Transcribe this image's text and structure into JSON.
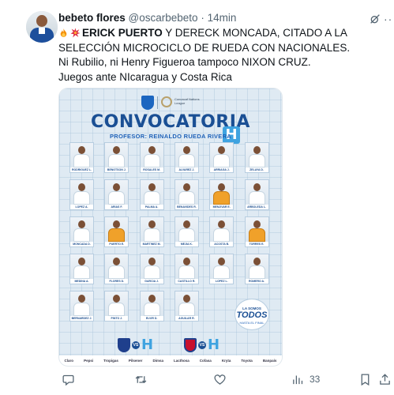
{
  "tweet": {
    "author_name": "bebeto flores",
    "handle": "@oscarbebeto",
    "separator": "·",
    "time": "14min",
    "lines": [
      {
        "prefix": "",
        "bold": "ERICK PUERTO",
        "rest": " Y DERECK MONCADA, CITADO A LA SELECCIÓN MICROCICLO DE RUEDA CON NACIONALES."
      },
      {
        "prefix": "",
        "bold": "",
        "rest": "Ni Rubilio, ni Henry Figueroa tampoco NIXON CRUZ."
      },
      {
        "prefix": "",
        "bold": "",
        "rest": "Juegos ante NIcaragua y Costa Rica"
      }
    ],
    "emojis": [
      "fire-emoji",
      "collision-emoji"
    ]
  },
  "poster": {
    "title": "CONVOCATORIA",
    "title_badge": "H",
    "subtitle": "PROFESOR: REINALDO RUEDA RIVERA",
    "brand_text": "Concacaf Nations League",
    "players": [
      {
        "name": "RODRIGUEZ L.",
        "gk": false
      },
      {
        "name": "BENGTSON J.",
        "gk": false
      },
      {
        "name": "ROSALES M.",
        "gk": false
      },
      {
        "name": "ALVAREZ J.",
        "gk": false
      },
      {
        "name": "ARRIAGA J.",
        "gk": false
      },
      {
        "name": "ZELAYA D.",
        "gk": false
      },
      {
        "name": "LOPEZ A.",
        "gk": false
      },
      {
        "name": "ARIAS F.",
        "gk": false
      },
      {
        "name": "PALMA A.",
        "gk": false
      },
      {
        "name": "BENAVIDES R.",
        "gk": false
      },
      {
        "name": "MENJIVAR E.",
        "gk": true
      },
      {
        "name": "ARBOLEDA L.",
        "gk": false
      },
      {
        "name": "MONCADA D.",
        "gk": false
      },
      {
        "name": "PUERTO E.",
        "gk": true
      },
      {
        "name": "MARTINEZ M.",
        "gk": false
      },
      {
        "name": "MEJIA K.",
        "gk": false
      },
      {
        "name": "ACOSTA B.",
        "gk": false
      },
      {
        "name": "TORRES E.",
        "gk": true
      },
      {
        "name": "MEDINA A.",
        "gk": false
      },
      {
        "name": "FLORES D.",
        "gk": false
      },
      {
        "name": "GARCIA J.",
        "gk": false
      },
      {
        "name": "CASTILLO R.",
        "gk": false
      },
      {
        "name": "LOPEZ L.",
        "gk": false
      },
      {
        "name": "ROMERO A.",
        "gk": false
      },
      {
        "name": "BERNARDEZ J.",
        "gk": false
      },
      {
        "name": "PINTO J.",
        "gk": false
      },
      {
        "name": "ELVIR D.",
        "gk": false
      },
      {
        "name": "AGUILAR R.",
        "gk": false
      }
    ],
    "todos": {
      "top": "LA SOMOS",
      "main": "TODOS",
      "bottom": "HASTA EL FINAL"
    },
    "matches": [
      {
        "team_color": "#1f3f8c",
        "vs": "VS",
        "home": "H"
      },
      {
        "team_color": "#c8102e",
        "vs": "VS",
        "home": "H"
      }
    ],
    "sponsors": [
      "Claro",
      "Pepsi",
      "Tropigas",
      "Pilsener",
      "Dimsa",
      "Lacthosa",
      "Cofasa",
      "Kryta",
      "Toyota",
      "Banpaís"
    ]
  },
  "actions": {
    "reply_count": "",
    "retweet_count": "",
    "like_count": "",
    "views_count": "33",
    "bookmark_count": ""
  },
  "colors": {
    "poster_blue": "#1a4f94",
    "accent_sky": "#3fa3e0",
    "muted_text": "#536471"
  },
  "icons": [
    "grok-icon",
    "more-icon",
    "reply-icon",
    "retweet-icon",
    "like-icon",
    "views-icon",
    "bookmark-icon",
    "share-icon"
  ]
}
